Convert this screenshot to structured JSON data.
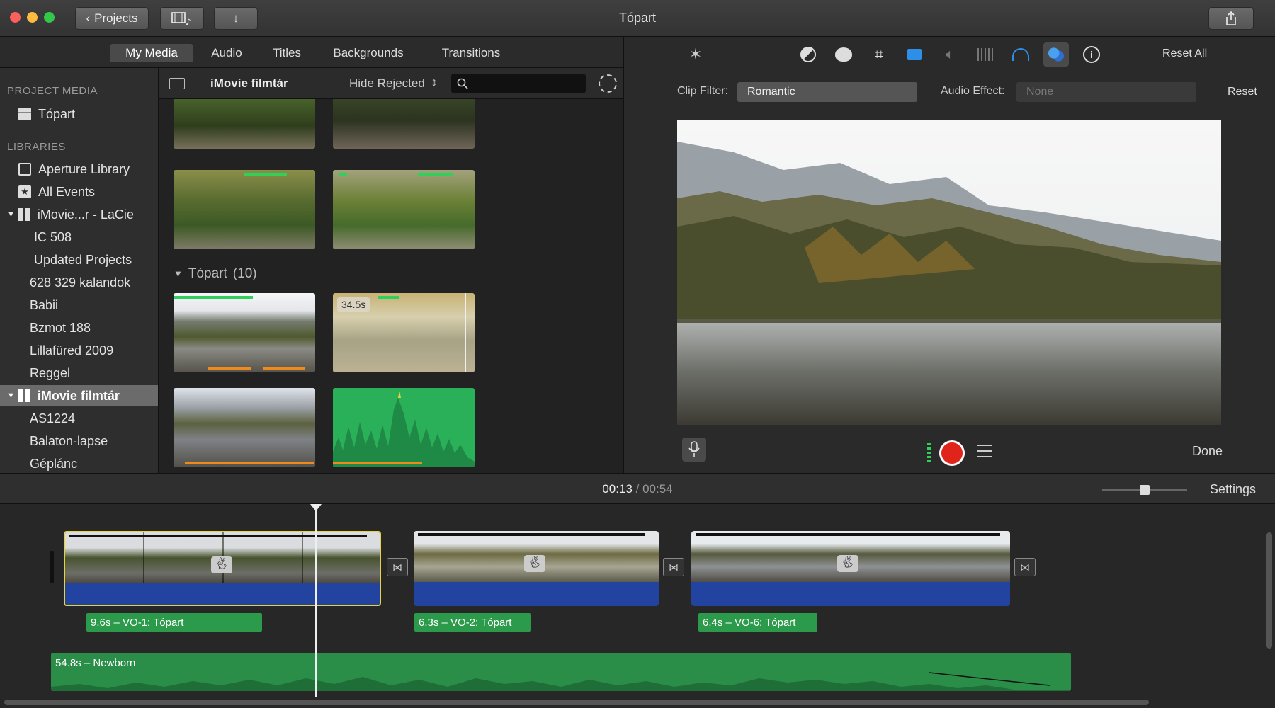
{
  "window": {
    "title": "Tópart",
    "projects_button": "Projects"
  },
  "tabs": {
    "my_media": "My Media",
    "audio": "Audio",
    "titles": "Titles",
    "backgrounds": "Backgrounds",
    "transitions": "Transitions"
  },
  "sidebar": {
    "project_media_heading": "PROJECT MEDIA",
    "project_item": "Tópart",
    "libraries_heading": "LIBRARIES",
    "items": [
      "Aperture Library",
      "All Events",
      "iMovie...r - LaCie",
      "IC 508",
      "Updated Projects",
      "628 329 kalandok",
      "Babii",
      "Bzmot 188",
      "Lillafüred 2009",
      "Reggel",
      "iMovie filmtár",
      "AS1224",
      "Balaton-lapse",
      "Géplánc"
    ]
  },
  "browser": {
    "library_title": "iMovie filmtár",
    "hide_rejected": "Hide Rejected",
    "search_value": "",
    "event_title": "Tópart",
    "event_count": "(10)",
    "thumb_duration": "34.5s"
  },
  "inspector": {
    "reset_all": "Reset All",
    "clip_filter_label": "Clip Filter:",
    "clip_filter_value": "Romantic",
    "audio_effect_label": "Audio Effect:",
    "audio_effect_value": "None",
    "reset": "Reset",
    "done": "Done"
  },
  "timeline": {
    "current_time": "00:13",
    "separator": "/",
    "total_time": "00:54",
    "settings": "Settings",
    "voiceovers": [
      "9.6s – VO-1: Tópart",
      "6.3s – VO-2: Tópart",
      "6.4s – VO-6: Tópart"
    ],
    "music": "54.8s – Newborn",
    "zoom_level": 0.5
  },
  "colors": {
    "accent_blue": "#2e6fd6",
    "audio_blue": "#2244a0",
    "voiceover_green": "#2b9a4a",
    "record_red": "#e0241b",
    "selection_yellow": "#e8d33a"
  },
  "icons": [
    "chevron-left-icon",
    "filmstrip-music-icon",
    "download-arrow-icon",
    "share-icon",
    "sidebar-toggle-icon",
    "search-icon",
    "gear-icon",
    "magic-wand-icon",
    "color-balance-icon",
    "color-correction-icon",
    "crop-icon",
    "stabilization-icon",
    "volume-icon",
    "equalizer-icon",
    "speed-icon",
    "clip-filter-icon",
    "info-icon",
    "microphone-icon",
    "record-button-icon",
    "voiceover-options-icon",
    "transition-icon"
  ]
}
